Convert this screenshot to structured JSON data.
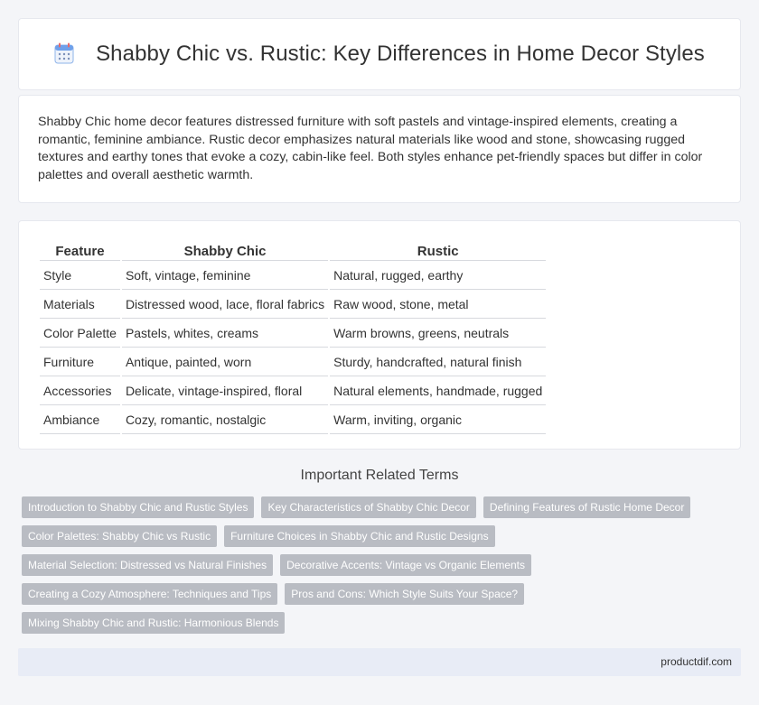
{
  "header": {
    "title": "Shabby Chic vs. Rustic: Key Differences in Home Decor Styles",
    "icon": "calendar-icon"
  },
  "intro": {
    "text": "Shabby Chic home decor features distressed furniture with soft pastels and vintage-inspired elements, creating a romantic, feminine ambiance. Rustic decor emphasizes natural materials like wood and stone, showcasing rugged textures and earthy tones that evoke a cozy, cabin-like feel. Both styles enhance pet-friendly spaces but differ in color palettes and overall aesthetic warmth."
  },
  "table": {
    "headers": [
      "Feature",
      "Shabby Chic",
      "Rustic"
    ],
    "rows": [
      [
        "Style",
        "Soft, vintage, feminine",
        "Natural, rugged, earthy"
      ],
      [
        "Materials",
        "Distressed wood, lace, floral fabrics",
        "Raw wood, stone, metal"
      ],
      [
        "Color Palette",
        "Pastels, whites, creams",
        "Warm browns, greens, neutrals"
      ],
      [
        "Furniture",
        "Antique, painted, worn",
        "Sturdy, handcrafted, natural finish"
      ],
      [
        "Accessories",
        "Delicate, vintage-inspired, floral",
        "Natural elements, handmade, rugged"
      ],
      [
        "Ambiance",
        "Cozy, romantic, nostalgic",
        "Warm, inviting, organic"
      ]
    ]
  },
  "related": {
    "title": "Important Related Terms",
    "tags": [
      "Introduction to Shabby Chic and Rustic Styles",
      "Key Characteristics of Shabby Chic Decor",
      "Defining Features of Rustic Home Decor",
      "Color Palettes: Shabby Chic vs Rustic",
      "Furniture Choices in Shabby Chic and Rustic Designs",
      "Material Selection: Distressed vs Natural Finishes",
      "Decorative Accents: Vintage vs Organic Elements",
      "Creating a Cozy Atmosphere: Techniques and Tips",
      "Pros and Cons: Which Style Suits Your Space?",
      "Mixing Shabby Chic and Rustic: Harmonious Blends"
    ]
  },
  "footer": {
    "site": "productdif.com"
  },
  "colors": {
    "background": "#f4f5f8",
    "tag": "#b9bcc3",
    "footer": "#e8ecf6",
    "icon_blue": "#4a8fe0",
    "icon_red": "#e86a6a"
  }
}
